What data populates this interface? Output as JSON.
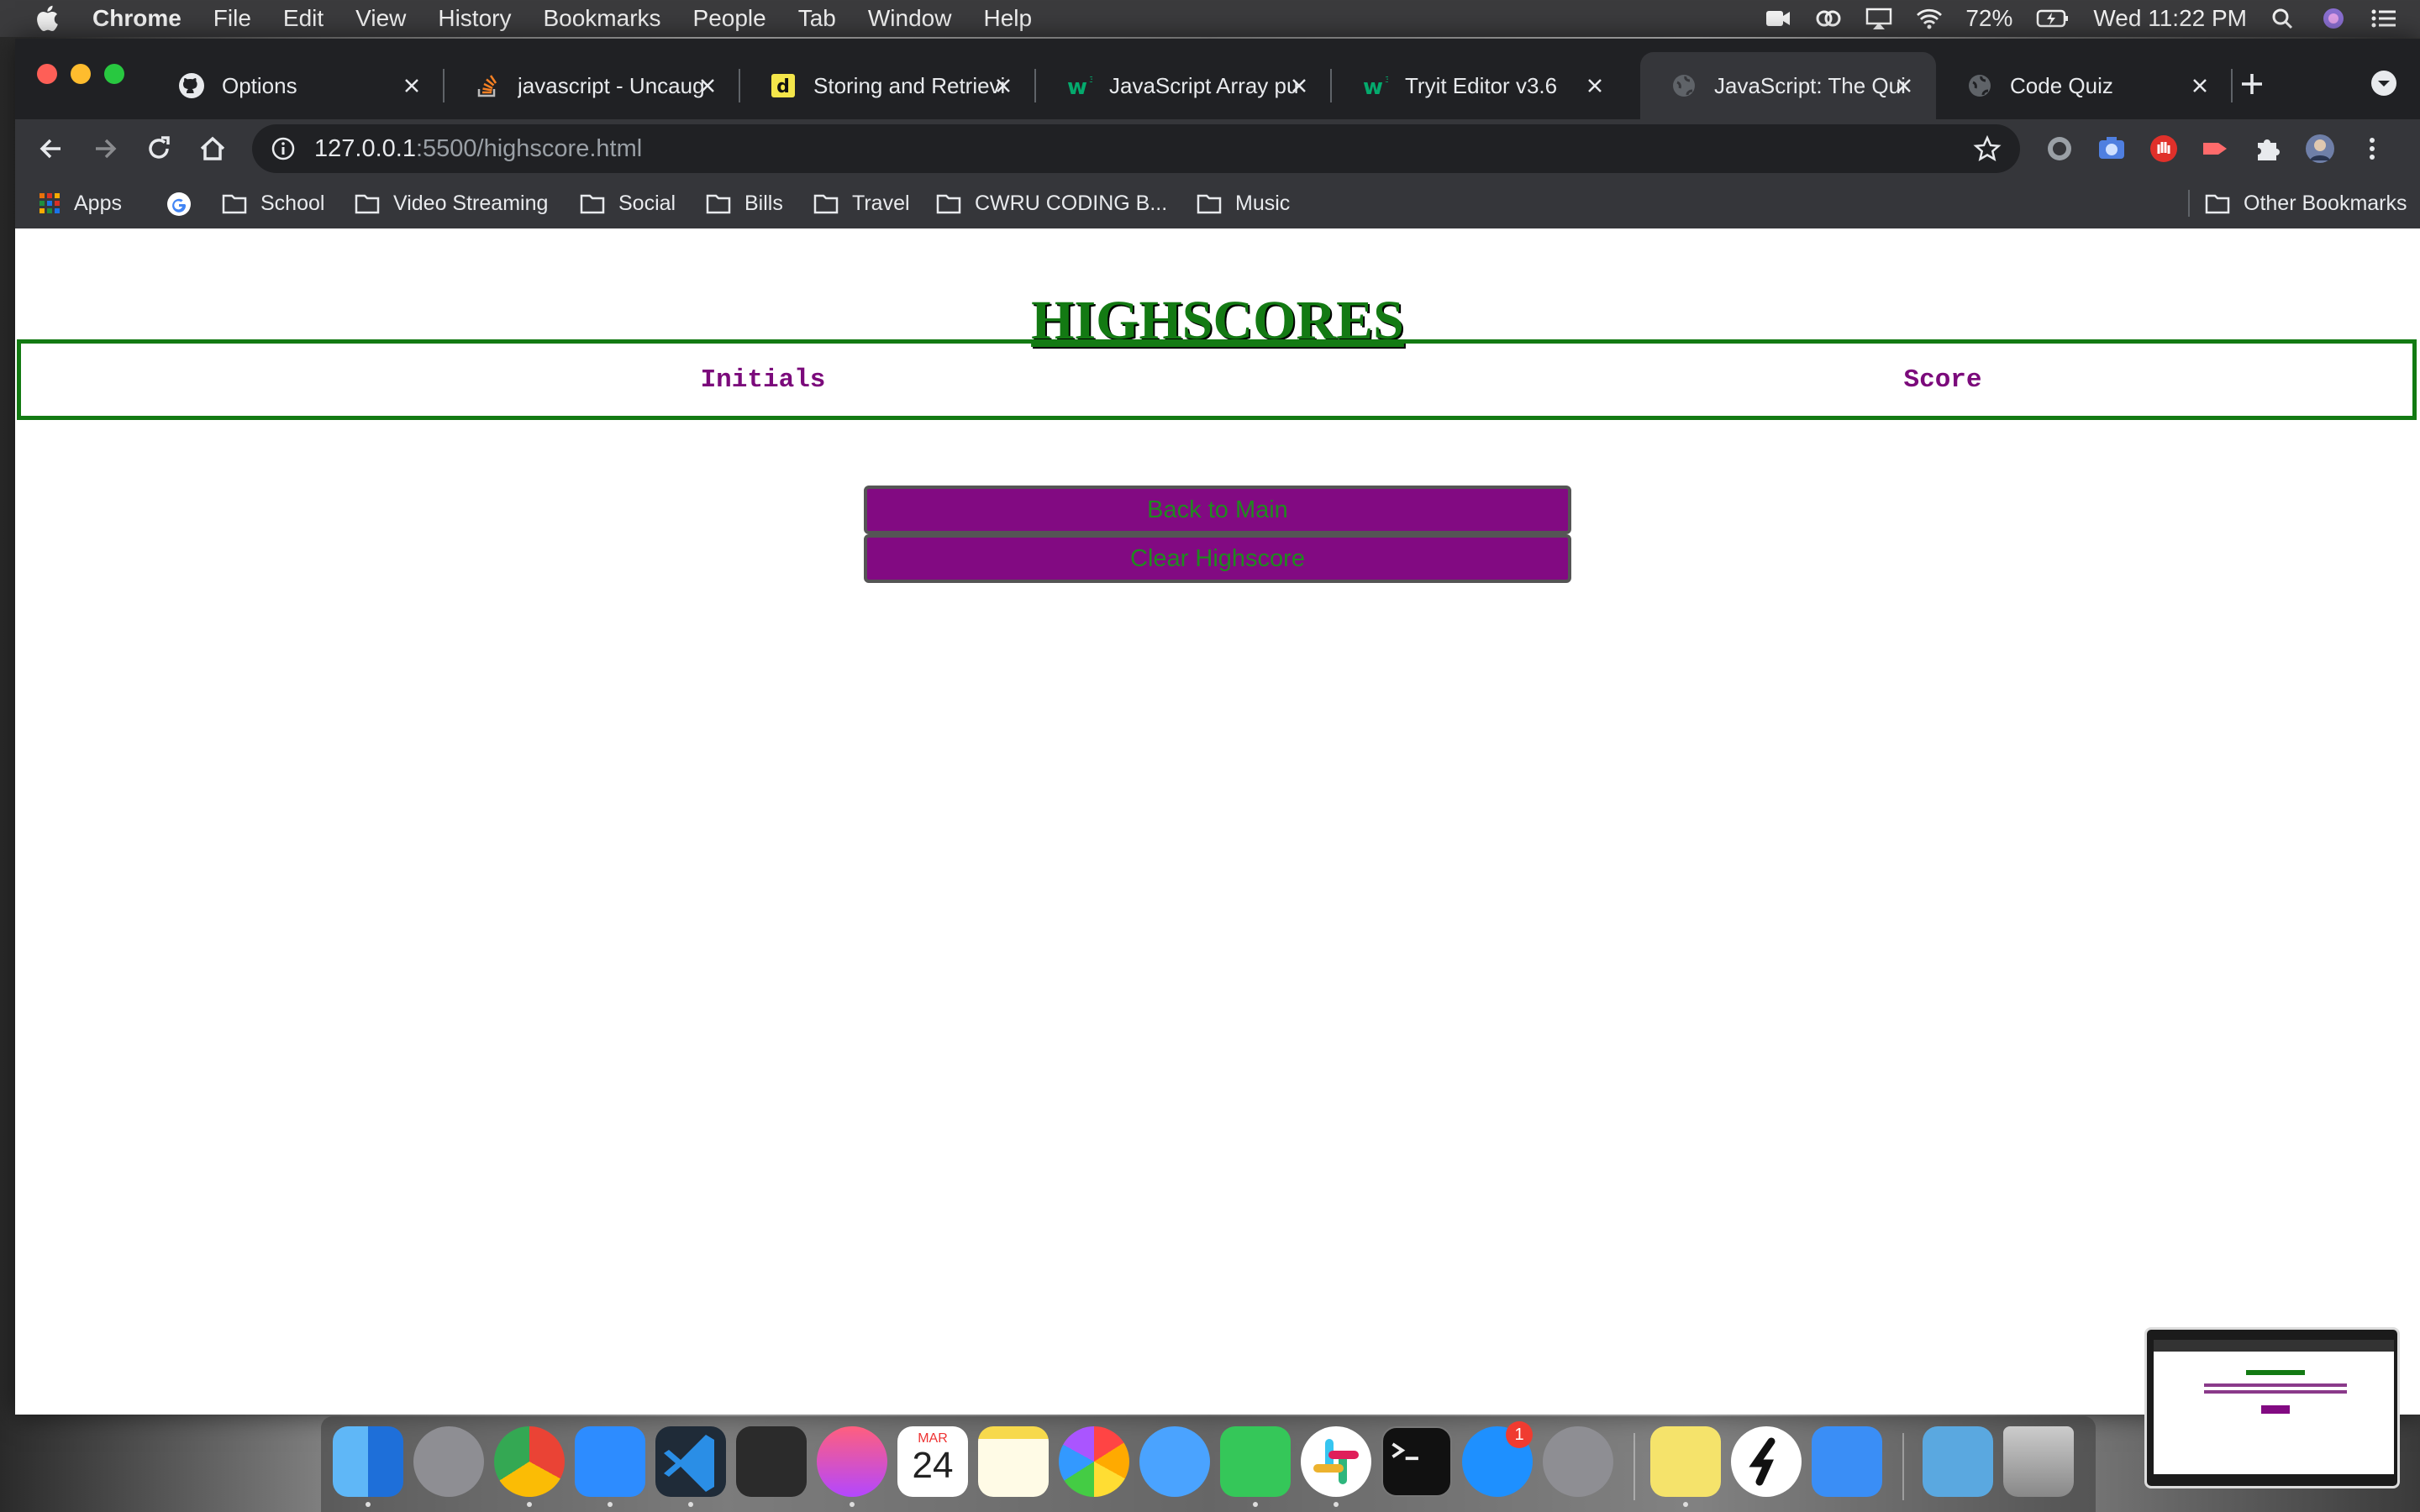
{
  "menubar": {
    "app_name": "Chrome",
    "menus": [
      "File",
      "Edit",
      "View",
      "History",
      "Bookmarks",
      "People",
      "Tab",
      "Window",
      "Help"
    ],
    "battery": "72%",
    "clock": "Wed 11:22 PM"
  },
  "tabs": [
    {
      "title": "Options",
      "icon": "github-icon"
    },
    {
      "title": "javascript - Uncaug",
      "icon": "stackoverflow-icon"
    },
    {
      "title": "Storing and Retrievi",
      "icon": "dev-icon"
    },
    {
      "title": "JavaScript Array pu",
      "icon": "w3schools-icon"
    },
    {
      "title": "Tryit Editor v3.6",
      "icon": "w3schools-icon"
    },
    {
      "title": "JavaScript: The Qui",
      "icon": "globe-icon",
      "active": true
    },
    {
      "title": "Code Quiz",
      "icon": "globe-icon"
    }
  ],
  "address": {
    "host": "127.0.0.1",
    "path": ":5500/highscore.html"
  },
  "bookmarks": {
    "apps": "Apps",
    "folders": [
      "School",
      "Video Streaming",
      "Social",
      "Bills",
      "Travel",
      "CWRU CODING B...",
      "Music"
    ],
    "other": "Other Bookmarks"
  },
  "page": {
    "title": "HIGHSCORES",
    "table": {
      "headers": [
        "Initials",
        "Score"
      ]
    },
    "buttons": {
      "back": "Back to Main",
      "clear": "Clear Highscore"
    }
  },
  "dock": {
    "calendar_month": "MAR",
    "calendar_day": "24",
    "appstore_badge": "1"
  },
  "colors": {
    "title_green": "#137a13",
    "header_purple": "#7b0a7b",
    "button_purple": "#820a82"
  }
}
